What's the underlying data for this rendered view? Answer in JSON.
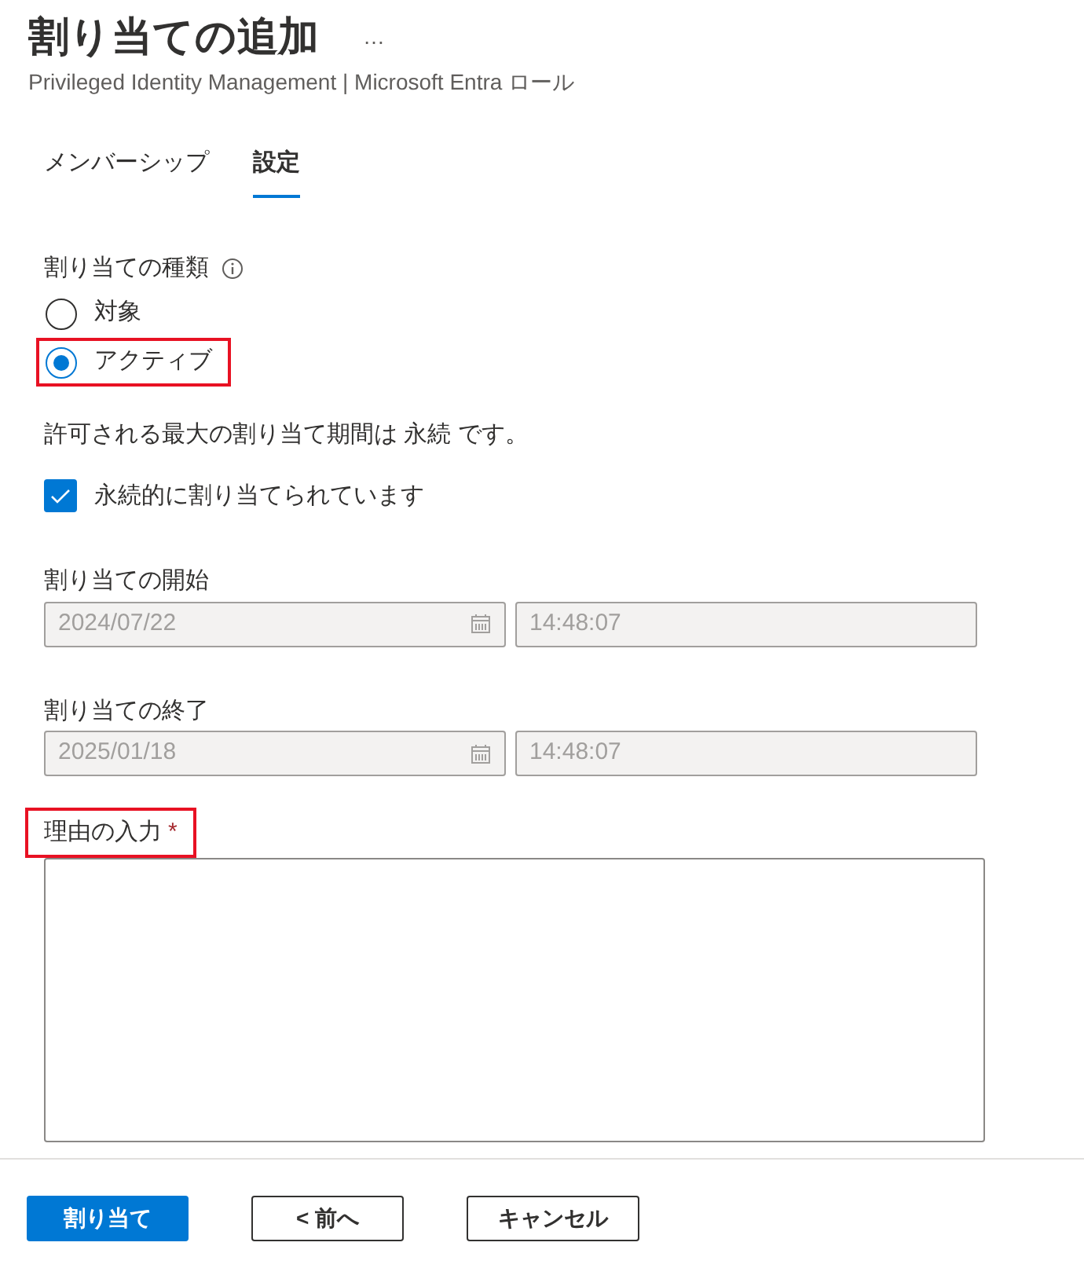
{
  "header": {
    "title": "割り当ての追加",
    "more": "…",
    "subtitle": "Privileged Identity Management | Microsoft Entra ロール"
  },
  "tabs": [
    {
      "label": "メンバーシップ",
      "selected": false
    },
    {
      "label": "設定",
      "selected": true
    }
  ],
  "assignment_type": {
    "label": "割り当ての種類",
    "options": [
      {
        "label": "対象",
        "selected": false,
        "highlighted": false
      },
      {
        "label": "アクティブ",
        "selected": true,
        "highlighted": true
      }
    ]
  },
  "max_duration_text": "許可される最大の割り当て期間は 永続 です。",
  "permanent": {
    "label": "永続的に割り当てられています",
    "checked": true
  },
  "start": {
    "label": "割り当ての開始",
    "date": "2024/07/22",
    "time": "14:48:07",
    "disabled": true
  },
  "end": {
    "label": "割り当ての終了",
    "date": "2025/01/18",
    "time": "14:48:07",
    "disabled": true
  },
  "reason": {
    "label": "理由の入力",
    "required": "*",
    "highlighted": true
  },
  "buttons": [
    {
      "label": "割り当て",
      "kind": "primary"
    },
    {
      "label": "< 前へ",
      "kind": "default"
    },
    {
      "label": "キャンセル",
      "kind": "default"
    }
  ]
}
